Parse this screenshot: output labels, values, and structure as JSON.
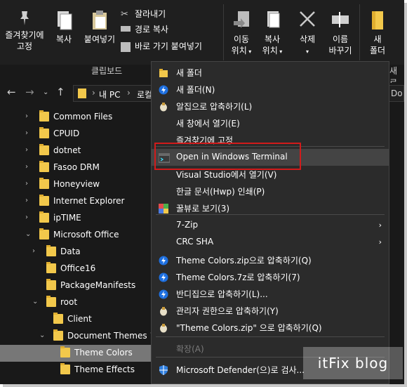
{
  "ribbon": {
    "pin_label_l1": "즐겨찾기에",
    "pin_label_l2": "고정",
    "copy_label": "복사",
    "paste_label": "붙여넣기",
    "cut_label": "잘라내기",
    "copy_path_label": "경로 복사",
    "paste_shortcut_label": "바로 가기 붙여넣기",
    "move_label_l1": "이동",
    "move_label_l2": "위치",
    "copyto_label_l1": "복사",
    "copyto_label_l2": "위치",
    "delete_label": "삭제",
    "rename_label_l1": "이름",
    "rename_label_l2": "바꾸기",
    "newfolder_label_l1": "새",
    "newfolder_label_l2": "폴더",
    "clipboard_group": "클립보드",
    "new_group_partial": "새로"
  },
  "address": {
    "path_part1": "내 PC",
    "path_part2": "로컬",
    "right_partial": "Do"
  },
  "tree": [
    {
      "label": "Common Files",
      "chev": "›"
    },
    {
      "label": "CPUID",
      "chev": "›"
    },
    {
      "label": "dotnet",
      "chev": "›"
    },
    {
      "label": "Fasoo DRM",
      "chev": "›"
    },
    {
      "label": "Honeyview",
      "chev": "›"
    },
    {
      "label": "Internet Explorer",
      "chev": "›"
    },
    {
      "label": "ipTIME",
      "chev": "›"
    },
    {
      "label": "Microsoft Office",
      "chev": "⌄"
    },
    {
      "label": "Data",
      "chev": "›"
    },
    {
      "label": "Office16",
      "chev": ""
    },
    {
      "label": "PackageManifests",
      "chev": ""
    },
    {
      "label": "root",
      "chev": "⌄"
    },
    {
      "label": "Client",
      "chev": ""
    },
    {
      "label": "Document Themes 16",
      "chev": "⌄"
    },
    {
      "label": "Theme Colors",
      "chev": ""
    },
    {
      "label": "Theme Effects",
      "chev": ""
    }
  ],
  "menu": [
    {
      "label": "새 폴더",
      "icon": "folder-icon"
    },
    {
      "label": "새 폴더(N)",
      "icon": "bandizip-icon"
    },
    {
      "label": "알집으로 압축하기(L)",
      "icon": "alzip-icon"
    },
    {
      "label": "새 창에서 열기(E)",
      "icon": ""
    },
    {
      "label": "즐겨찾기에 고정",
      "icon": ""
    },
    {
      "label": "Open in Windows Terminal",
      "icon": "terminal-icon"
    },
    {
      "label": "Visual Studio에서 열기(V)",
      "icon": ""
    },
    {
      "label": "한글 문서(Hwp) 인쇄(P)",
      "icon": ""
    },
    {
      "label": "꿀뷰로 보기(3)",
      "icon": "honeyview-icon"
    },
    {
      "label": "7-Zip",
      "icon": ""
    },
    {
      "label": "CRC SHA",
      "icon": ""
    },
    {
      "label": "Theme Colors.zip으로 압축하기(Q)",
      "icon": "bandizip-icon"
    },
    {
      "label": "Theme Colors.7z로 압축하기(7)",
      "icon": "bandizip-icon"
    },
    {
      "label": "반디집으로 압축하기(L)...",
      "icon": "bandizip-icon"
    },
    {
      "label": "관리자 권한으로 압축하기(Y)",
      "icon": "alzip-icon"
    },
    {
      "label": "\"Theme Colors.zip\" 으로 압축하기(Q)",
      "icon": "alzip-icon"
    },
    {
      "label": "확장(A)",
      "icon": ""
    },
    {
      "label": "Microsoft Defender(으)로 검사...",
      "icon": "defender-icon"
    }
  ],
  "watermark": "itFix blog",
  "colors": {
    "background": "#191919",
    "folder": "#f2c84b",
    "highlight_border": "#d11b1b",
    "menu_bg": "#2b2b2b"
  }
}
